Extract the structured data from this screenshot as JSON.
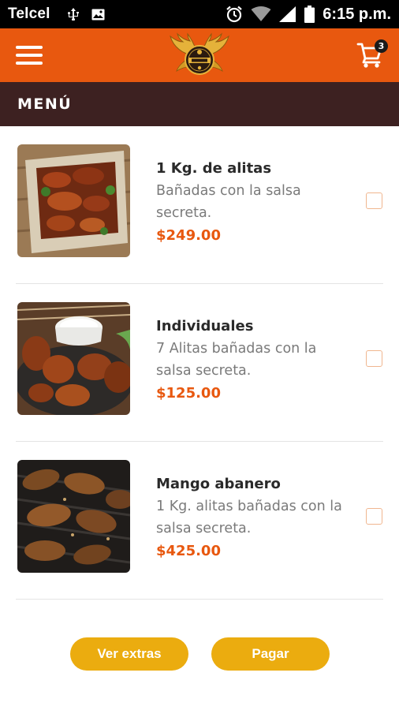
{
  "status_bar": {
    "carrier": "Telcel",
    "time": "6:15 p.m.",
    "icons": [
      "usb-icon",
      "image-icon",
      "alarm-icon",
      "wifi-icon",
      "signal-icon",
      "battery-icon"
    ]
  },
  "app_bar": {
    "menu_icon": "hamburger-menu-icon",
    "logo_icon": "winged-logo-icon",
    "cart_icon": "shopping-cart-icon",
    "cart_count": "3",
    "colors": {
      "background": "#E8580F",
      "badge": "#1a1a1a"
    }
  },
  "section": {
    "title": "MENÚ",
    "color": "#3d2121"
  },
  "menu_items": [
    {
      "name": "1 Kg. de alitas",
      "description": "Bañadas con la salsa secreta.",
      "price": "$249.00",
      "image": "wings-on-paper-image",
      "checked": false
    },
    {
      "name": "Individuales",
      "description": "7 Alitas bañadas con la salsa secreta.",
      "price": "$125.00",
      "image": "wings-with-dip-image",
      "checked": false
    },
    {
      "name": "Mango abanero",
      "description": "1 Kg. alitas bañadas con la salsa secreta.",
      "price": "$425.00",
      "image": "grilled-wings-image",
      "checked": false
    }
  ],
  "actions": {
    "extras_label": "Ver extras",
    "pay_label": "Pagar",
    "button_color": "#EBAC0F"
  },
  "accent_color": "#E8580F"
}
